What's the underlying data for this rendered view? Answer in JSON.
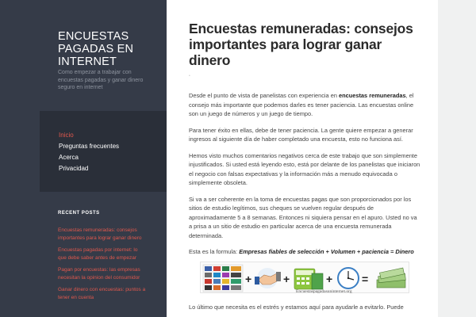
{
  "site": {
    "title": "ENCUESTAS PAGADAS EN INTERNET",
    "description": "Como empezar a trabajar con encuestas pagadas y ganar dinero seguro en internet"
  },
  "menu": {
    "items": [
      {
        "label": "Inicio",
        "active": true
      },
      {
        "label": "Preguntas frecuentes"
      },
      {
        "label": "Acerca"
      },
      {
        "label": "Privacidad"
      }
    ]
  },
  "recent": {
    "heading": "RECENT POSTS",
    "items": [
      "Encuestas remuneradas: consejos importantes para lograr ganar dinero",
      "Encuestas pagadas por internet: lo que debe saber antes de empezar",
      "Pagan por encuestas: las empresas necesitan la opinion del consumidor",
      "Ganar dinero con encuestas: puntos a tener en cuenta"
    ]
  },
  "post": {
    "title": "Encuestas remuneradas: consejos importantes para lograr ganar dinero",
    "paragraphs": {
      "p1_pre": "Desde el punto de vista de panelistas con experiencia en ",
      "p1_bold": "encuestas remuneradas",
      "p1_post": ", el consejo más importante que podemos darles es tener paciencia. Las encuestas online son un juego de números y un juego de tiempo.",
      "p2": "Para tener éxito en ellas, debe de tener paciencia. La gente quiere empezar a generar ingresos al siguiente día de haber completado una encuesta, esto no funciona así.",
      "p3": "Hemos visto muchos comentarios negativos cerca de este trabajo que son simplemente injustificados. Si usted está leyendo esto, está por delante de los panelistas que iniciaron el negocio con falsas expectativas y la información más a menudo equivocada o simplemente obsoleta.",
      "p4": "Si va a ser coherente en la toma de encuestas pagas que son proporcionados por los sitios de estudio legítimos, sus cheques se vuelven regular después de aproximadamente 5 a 8 semanas. Entonces ni siquiera  pensar en el apuro. Usted no va a prisa a un sitio de estudio en particular acerca de una encuesta remunerada determinada.",
      "p5_pre": "Esta es la formula: ",
      "p5_formula": "Empresas fiables de selección + Volumen + paciencia = Dinero",
      "p6": "Lo último que necesita es el estrés y estamos aquí para ayudarle a evitarlo. Puede"
    },
    "formula_image": {
      "caption": "Encuestaspagadasuninternet.org",
      "operators": [
        "+",
        "+",
        "+",
        "="
      ]
    }
  },
  "colors": {
    "sidebar": "#353b48",
    "menu_box": "#2a2f39",
    "accent": "#e0584d",
    "page_bg": "#f0f1f1"
  }
}
